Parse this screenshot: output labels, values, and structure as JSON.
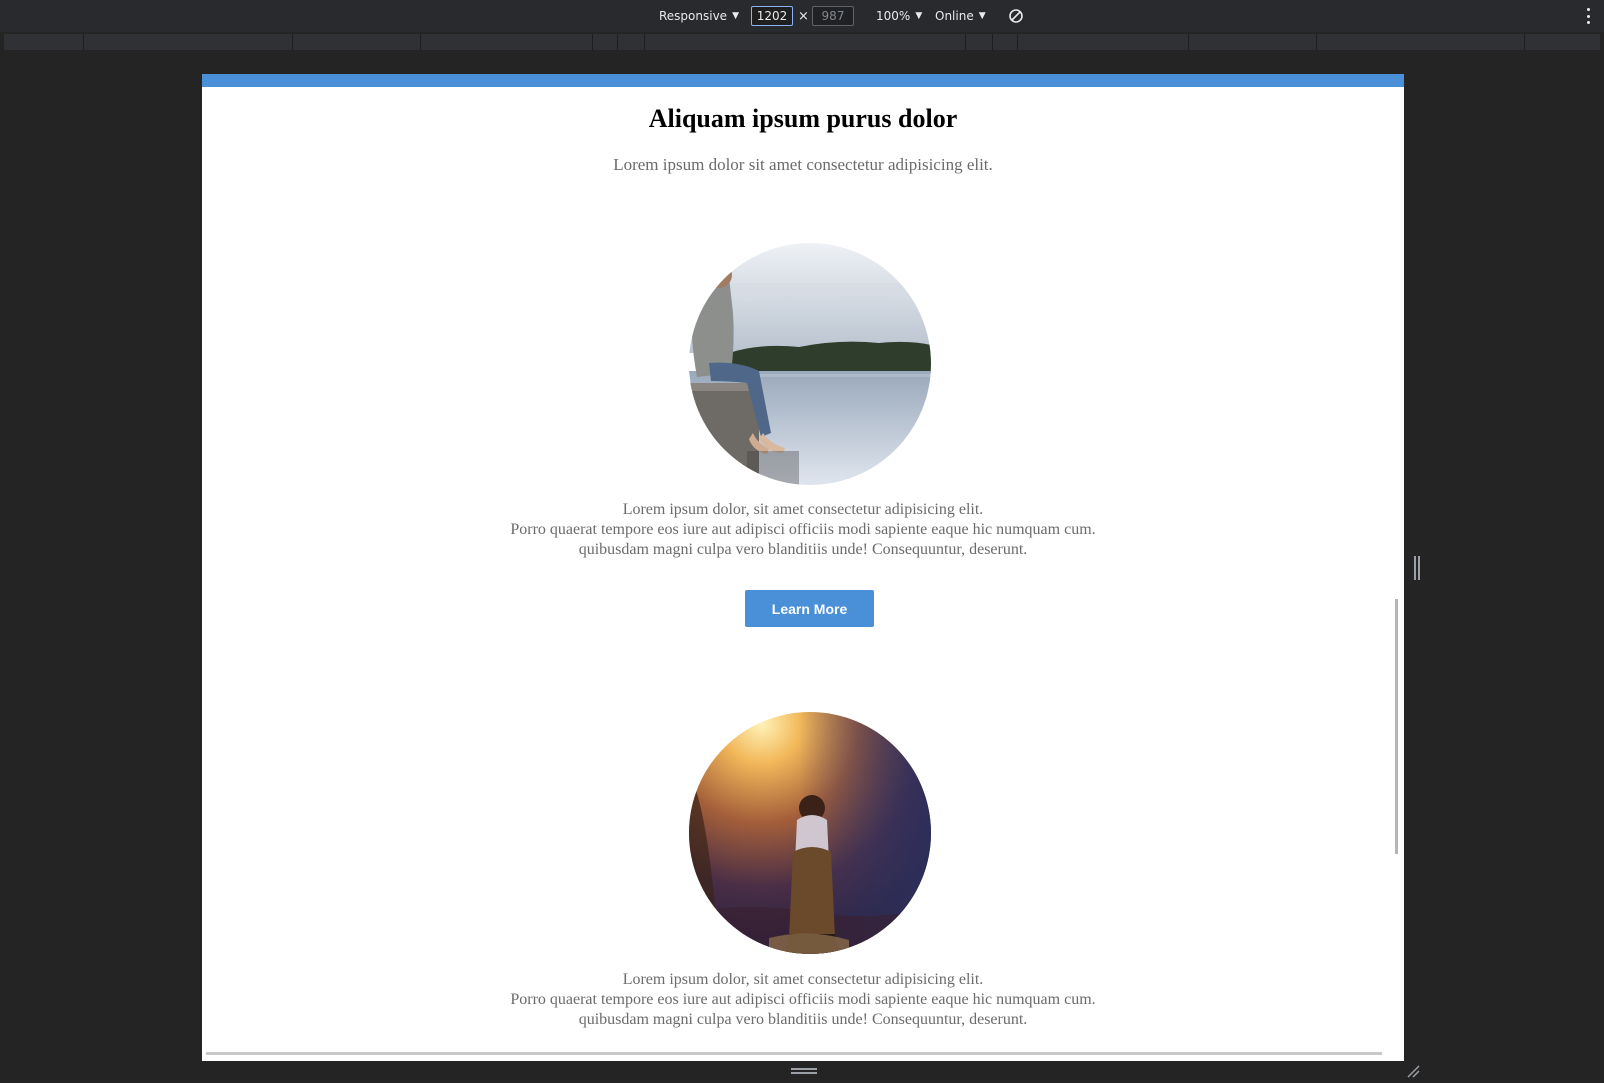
{
  "toolbar": {
    "device": "Responsive",
    "width": "1202",
    "times": "×",
    "height": "987",
    "zoom": "100%",
    "network": "Online",
    "rotate_icon": "rotate-disabled-icon",
    "more_icon": "more-vert-icon"
  },
  "page": {
    "title": "Aliquam ipsum purus dolor",
    "subtitle": "Lorem ipsum dolor sit amet consectetur adipisicing elit.",
    "accent_color": "#4a90d9",
    "features": [
      {
        "image": "man-sitting-on-dock-by-lake-photo",
        "lines": [
          "Lorem ipsum dolor, sit amet consectetur adipisicing elit.",
          "Porro quaerat tempore eos iure aut adipisci officiis modi sapiente eaque hic numquam cum.",
          "quibusdam magni culpa vero blanditiis unde! Consequuntur, deserunt."
        ],
        "button": "Learn More"
      },
      {
        "image": "person-in-hood-facing-canyon-sunset-photo",
        "lines": [
          "Lorem ipsum dolor, sit amet consectetur adipisicing elit.",
          "Porro quaerat tempore eos iure aut adipisci officiis modi sapiente eaque hic numquam cum.",
          "quibusdam magni culpa vero blanditiis unde! Consequuntur, deserunt."
        ]
      }
    ]
  }
}
